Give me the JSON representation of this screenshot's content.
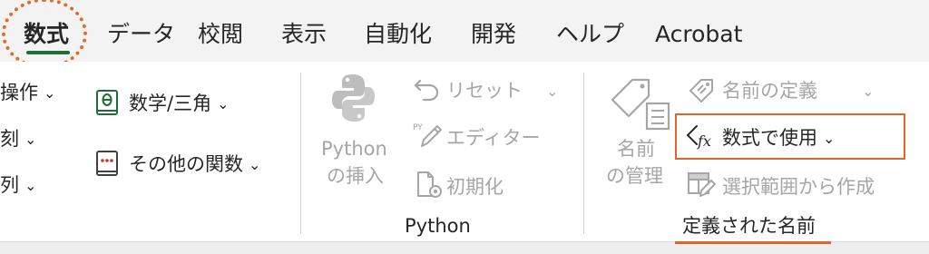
{
  "tabs": [
    {
      "label": "数式"
    },
    {
      "label": "データ"
    },
    {
      "label": "校閲"
    },
    {
      "label": "表示"
    },
    {
      "label": "自動化"
    },
    {
      "label": "開発"
    },
    {
      "label": "ヘルプ"
    },
    {
      "label": "Acrobat"
    }
  ],
  "left_partial": {
    "item1": "操作",
    "item2": "刻",
    "item3": "列"
  },
  "function_library": {
    "math_label": "数学/三角",
    "other_label": "その他の関数"
  },
  "python_group": {
    "insert_label_line1": "Python",
    "insert_label_line2": "の挿入",
    "reset_label": "リセット",
    "editor_label": "エディター",
    "initialize_label": "初期化",
    "group_label": "Python"
  },
  "defined_names": {
    "manager_line1": "名前",
    "manager_line2": "の管理",
    "define_name_label": "名前の定義",
    "use_in_formula_label": "数式で使用",
    "create_from_selection_label": "選択範囲から作成",
    "group_label": "定義された名前"
  },
  "colors": {
    "accent_orange": "#e0642c",
    "active_tab_underline": "#1e6e3c",
    "disabled_text": "#a6a6a6",
    "other_functions_icon": "#c0392b"
  }
}
